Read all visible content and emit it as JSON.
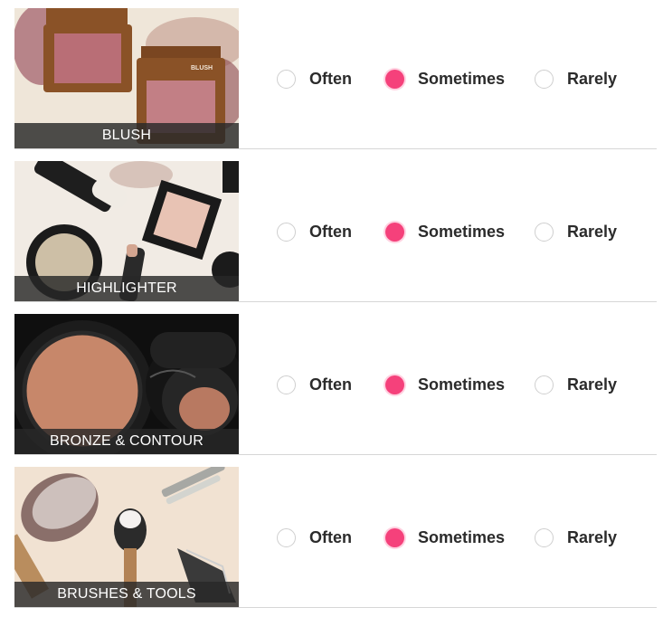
{
  "options": [
    "Often",
    "Sometimes",
    "Rarely"
  ],
  "accent_color": "#f5417b",
  "categories": [
    {
      "caption": "BLUSH",
      "selected": "Sometimes",
      "image": "blush-compacts-image"
    },
    {
      "caption": "HIGHLIGHTER",
      "selected": "Sometimes",
      "image": "highlighter-products-image"
    },
    {
      "caption": "BRONZE & CONTOUR",
      "selected": "Sometimes",
      "image": "bronzer-compact-image"
    },
    {
      "caption": "BRUSHES & TOOLS",
      "selected": "Sometimes",
      "image": "brushes-tools-image"
    }
  ]
}
